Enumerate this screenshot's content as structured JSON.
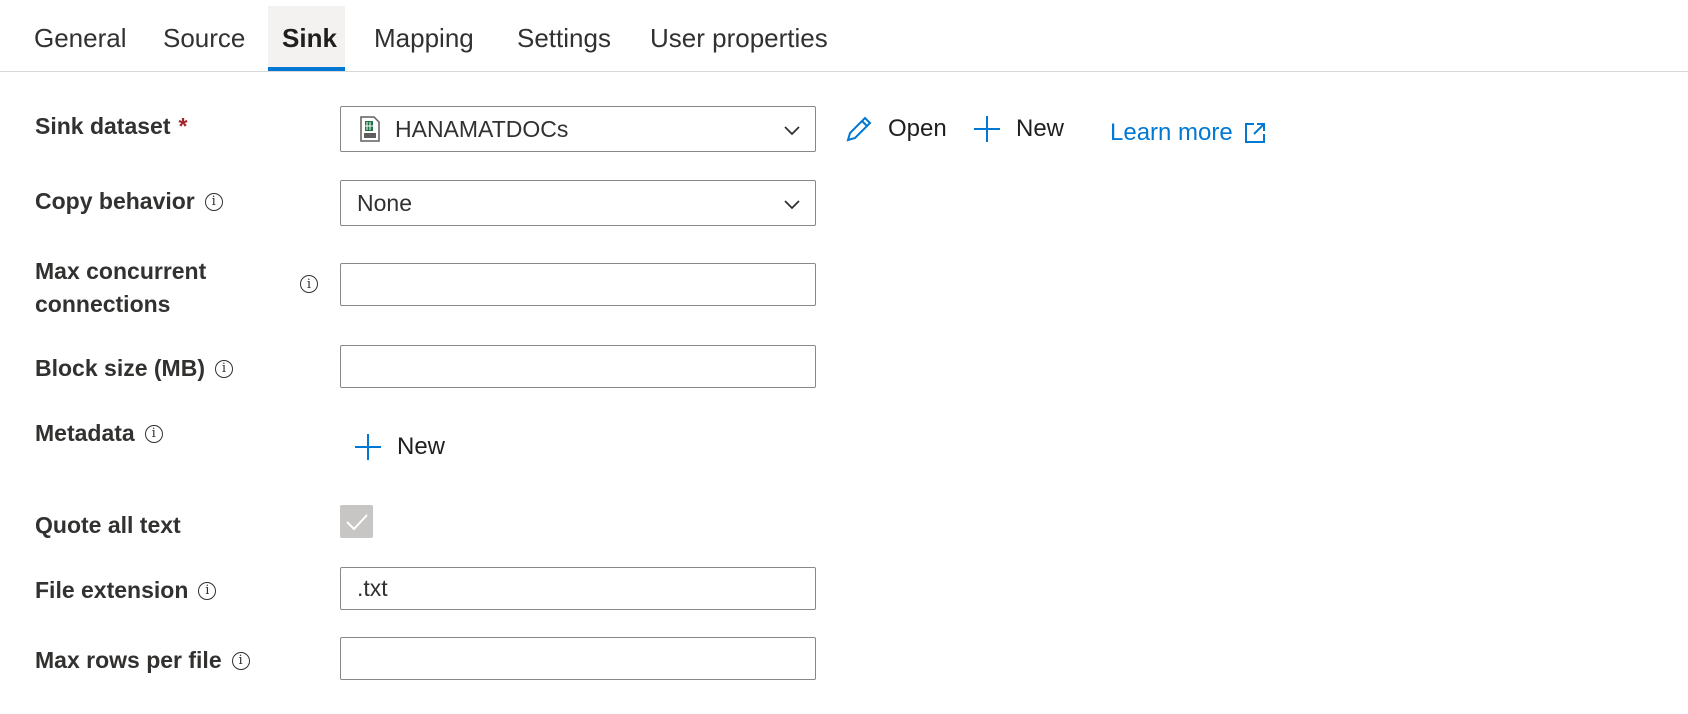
{
  "tabs": [
    {
      "label": "General"
    },
    {
      "label": "Source"
    },
    {
      "label": "Sink"
    },
    {
      "label": "Mapping"
    },
    {
      "label": "Settings"
    },
    {
      "label": "User properties"
    }
  ],
  "active_tab": "Sink",
  "form": {
    "sink_dataset": {
      "label": "Sink dataset",
      "required_mark": "*",
      "value": "HANAMATDOCs"
    },
    "open_label": "Open",
    "new_label": "New",
    "learn_more": "Learn more",
    "copy_behavior": {
      "label": "Copy behavior",
      "value": "None"
    },
    "max_concurrent": {
      "label_line1": "Max concurrent",
      "label_line2": "connections",
      "value": ""
    },
    "block_size": {
      "label": "Block size (MB)",
      "value": ""
    },
    "metadata": {
      "label": "Metadata",
      "new_label": "New"
    },
    "quote_all_text": {
      "label": "Quote all text",
      "checked": true
    },
    "file_extension": {
      "label": "File extension",
      "value": ".txt"
    },
    "max_rows": {
      "label": "Max rows per file",
      "value": ""
    }
  },
  "colors": {
    "accent": "#0078d4",
    "required": "#a4262c",
    "disabled_check": "#c8c6c4"
  },
  "icons": [
    "csv-file-icon",
    "chevron-down-icon",
    "pencil-icon",
    "plus-icon",
    "external-link-icon",
    "info-icon",
    "checkmark-icon"
  ]
}
